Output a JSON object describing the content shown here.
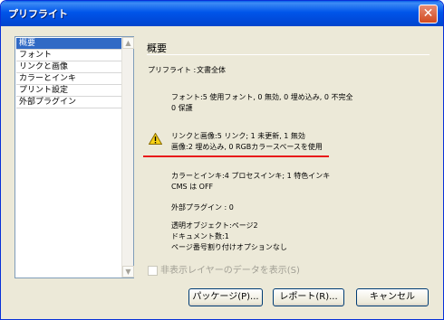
{
  "window": {
    "title": "プリフライト",
    "close_glyph": "✕"
  },
  "sidebar": {
    "items": [
      {
        "label": "概要",
        "selected": true
      },
      {
        "label": "フォント",
        "selected": false
      },
      {
        "label": "リンクと画像",
        "selected": false
      },
      {
        "label": "カラーとインキ",
        "selected": false
      },
      {
        "label": "プリント設定",
        "selected": false
      },
      {
        "label": "外部プラグイン",
        "selected": false
      }
    ]
  },
  "main": {
    "heading": "概要",
    "preflight_label": "プリフライト :",
    "preflight_value": "文書全体",
    "fonts_line1": "フォント:5 使用フォント, 0 無効, 0 埋め込み, 0 不完全",
    "fonts_line2": "0 保護",
    "links_line": "リンクと画像:5 リンク; 1 未更新, 1 無効",
    "images_line": "画像:2 埋め込み, 0 RGBカラースペースを使用",
    "colors_line": "カラーとインキ:4 プロセスインキ; 1 特色インキ",
    "cms_line": "CMS は OFF",
    "plugins_line": "外部プラグイン : 0",
    "transparency_line": "透明オブジェクト:ページ2",
    "documents_line": "ドキュメント数:1",
    "page_number_line": "ページ番号割り付けオプションなし"
  },
  "checkbox": {
    "label": "非表示レイヤーのデータを表示(S)",
    "checked": false,
    "enabled": false
  },
  "buttons": {
    "package": "パッケージ(P)...",
    "report": "レポート(R)...",
    "cancel": "キャンセル"
  },
  "colors": {
    "warning": "#e81a1a",
    "selection": "#316ac5"
  }
}
